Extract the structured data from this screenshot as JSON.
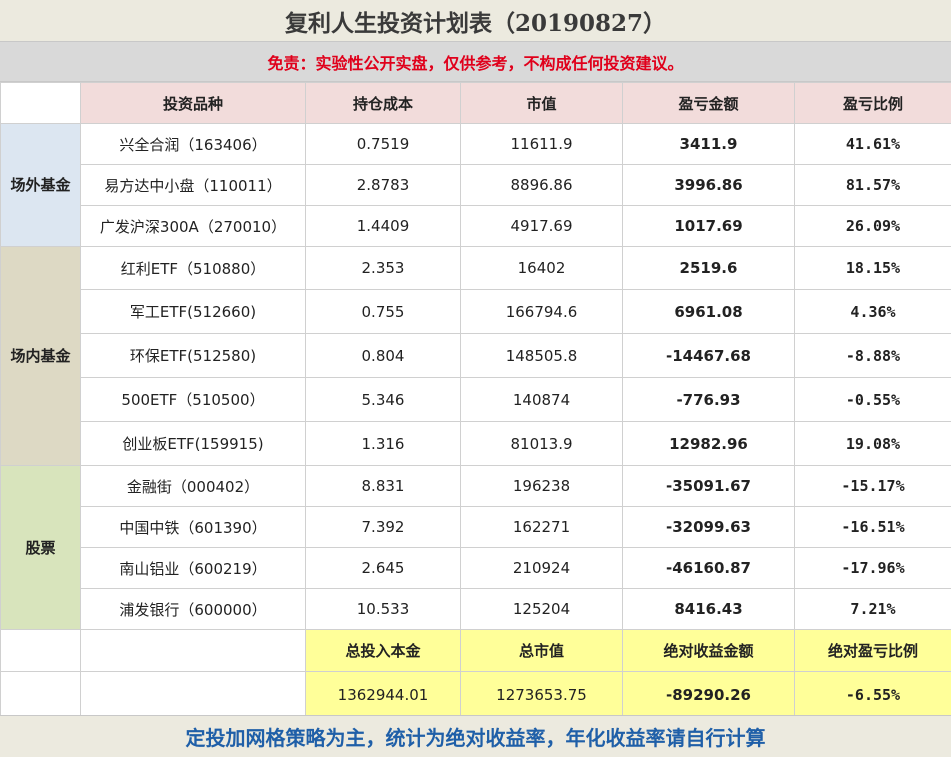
{
  "title": "复利人生投资计划表（20190827）",
  "disclaimer": "免责：实验性公开实盘，仅供参考，不构成任何投资建议。",
  "headers": [
    "投资品种",
    "持仓成本",
    "市值",
    "盈亏金额",
    "盈亏比例"
  ],
  "categories": {
    "otc": "场外基金",
    "etf": "场内基金",
    "stock": "股票"
  },
  "rows": [
    {
      "name": "兴全合润（163406）",
      "cost": "0.7519",
      "value": "11611.9",
      "pnl": "3411.9",
      "ratio": "41.61%"
    },
    {
      "name": "易方达中小盘（110011）",
      "cost": "2.8783",
      "value": "8896.86",
      "pnl": "3996.86",
      "ratio": "81.57%"
    },
    {
      "name": "广发沪深300A（270010）",
      "cost": "1.4409",
      "value": "4917.69",
      "pnl": "1017.69",
      "ratio": "26.09%"
    },
    {
      "name": "红利ETF（510880）",
      "cost": "2.353",
      "value": "16402",
      "pnl": "2519.6",
      "ratio": "18.15%"
    },
    {
      "name": "军工ETF(512660)",
      "cost": "0.755",
      "value": "166794.6",
      "pnl": "6961.08",
      "ratio": "4.36%"
    },
    {
      "name": "环保ETF(512580)",
      "cost": "0.804",
      "value": "148505.8",
      "pnl": "-14467.68",
      "ratio": "-8.88%"
    },
    {
      "name": "500ETF（510500）",
      "cost": "5.346",
      "value": "140874",
      "pnl": "-776.93",
      "ratio": "-0.55%"
    },
    {
      "name": "创业板ETF(159915)",
      "cost": "1.316",
      "value": "81013.9",
      "pnl": "12982.96",
      "ratio": "19.08%"
    },
    {
      "name": "金融街（000402）",
      "cost": "8.831",
      "value": "196238",
      "pnl": "-35091.67",
      "ratio": "-15.17%"
    },
    {
      "name": "中国中铁（601390）",
      "cost": "7.392",
      "value": "162271",
      "pnl": "-32099.63",
      "ratio": "-16.51%"
    },
    {
      "name": "南山铝业（600219）",
      "cost": "2.645",
      "value": "210924",
      "pnl": "-46160.87",
      "ratio": "-17.96%"
    },
    {
      "name": "浦发银行（600000）",
      "cost": "10.533",
      "value": "125204",
      "pnl": "8416.43",
      "ratio": "7.21%"
    }
  ],
  "summary": {
    "headers": [
      "总投入本金",
      "总市值",
      "绝对收益金额",
      "绝对盈亏比例"
    ],
    "values": [
      "1362944.01",
      "1273653.75",
      "-89290.26",
      "-6.55%"
    ]
  },
  "footer": "定投加网格策略为主，统计为绝对收益率，年化收益率请自行计算",
  "colors": {
    "gain": "#e0001b",
    "loss": "#1420c8",
    "header_bg": "#f2dcdb",
    "otc_bg": "#dce6f1",
    "etf_bg": "#ddd9c4",
    "stock_bg": "#d8e4bc",
    "summary_bg": "#ffff99",
    "footer_text": "#1f5fa8"
  }
}
